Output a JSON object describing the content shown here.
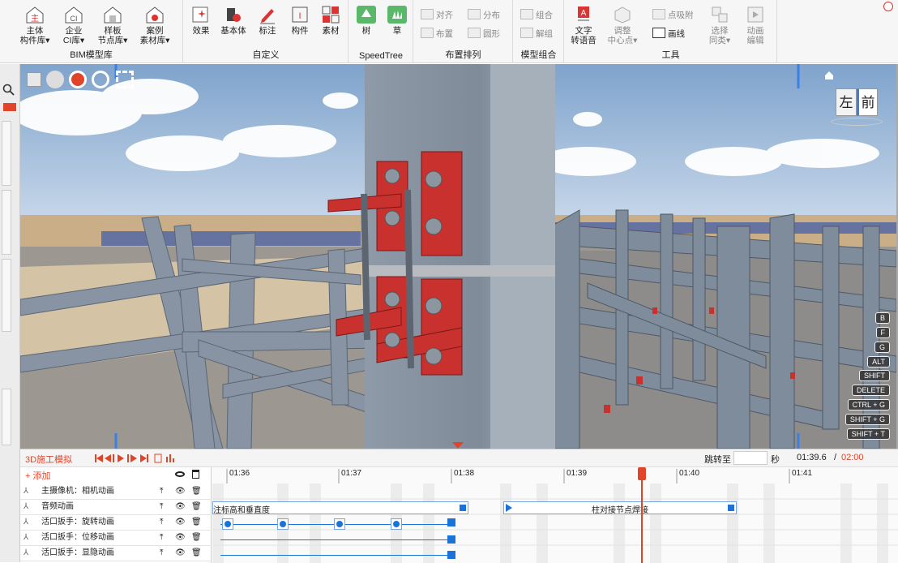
{
  "ribbon": {
    "groups": [
      {
        "title": "BIM模型库",
        "buttons": [
          {
            "line1": "主体",
            "line2": "构件库▾"
          },
          {
            "line1": "企业",
            "line2": "CI库▾"
          },
          {
            "line1": "样板",
            "line2": "节点库▾"
          },
          {
            "line1": "案例",
            "line2": "素材库▾"
          }
        ]
      },
      {
        "title": "自定义",
        "buttons": [
          {
            "line1": "效果",
            "line2": ""
          },
          {
            "line1": "基本体",
            "line2": ""
          },
          {
            "line1": "标注",
            "line2": ""
          },
          {
            "line1": "构件",
            "line2": ""
          },
          {
            "line1": "素材",
            "line2": ""
          }
        ]
      },
      {
        "title": "SpeedTree",
        "buttons": [
          {
            "line1": "树",
            "line2": ""
          },
          {
            "line1": "草",
            "line2": ""
          }
        ]
      },
      {
        "title": "布置排列",
        "small": [
          "对齐",
          "分布",
          "布置",
          "圆形"
        ]
      },
      {
        "title": "模型组合",
        "small": [
          "组合",
          "解组"
        ]
      },
      {
        "title": "工具",
        "buttons": [
          {
            "line1": "文字",
            "line2": "转语音"
          },
          {
            "line1": "调整",
            "line2": "中心点▾"
          },
          {
            "line1": "选择",
            "line2": "同类▾"
          },
          {
            "line1": "动画",
            "line2": "编辑"
          }
        ],
        "small": [
          "点吸附",
          "画线"
        ]
      }
    ]
  },
  "viewport": {
    "cube_left": "左",
    "cube_front": "前",
    "shortcuts": [
      "B",
      "F",
      "G",
      "ALT",
      "SHIFT",
      "DELETE",
      "CTRL + G",
      "SHIFT + G",
      "SHIFT + T"
    ]
  },
  "timeline": {
    "title": "3D施工模拟",
    "jump_label": "跳转至",
    "seconds_label": "秒",
    "current_time": "01:39.6",
    "separator": "/",
    "total_time": "02:00",
    "add_label": "+ 添加",
    "ticks": [
      "01:36",
      "01:37",
      "01:38",
      "01:39",
      "01:40",
      "01:41"
    ],
    "tracks": [
      {
        "name": "主摄像机：相机动画"
      },
      {
        "name": "音频动画"
      },
      {
        "name": "活口扳手：旋转动画"
      },
      {
        "name": "活口扳手：位移动画"
      },
      {
        "name": "活口扳手：显隐动画"
      }
    ],
    "clips": [
      {
        "label": "注标高和垂直度"
      },
      {
        "label": "柱对接节点焊接"
      }
    ]
  },
  "colors": {
    "accent": "#e0452a",
    "steel": "#7d8b9a",
    "plate": "#c9312f",
    "keyframe": "#1a73d9"
  }
}
